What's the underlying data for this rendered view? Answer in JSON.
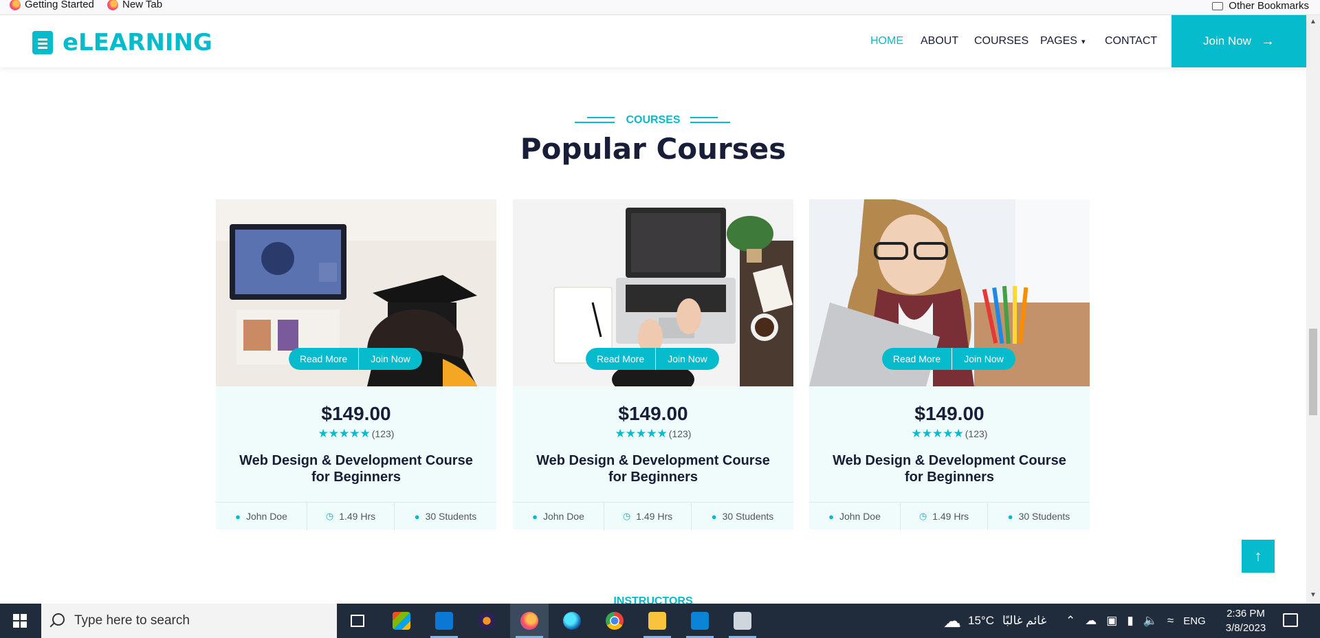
{
  "bookmarks": {
    "items": [
      {
        "label": "Getting Started"
      },
      {
        "label": "New Tab"
      }
    ],
    "other": "Other Bookmarks"
  },
  "nav": {
    "brand": "eLEARNING",
    "links": [
      "HOME",
      "ABOUT",
      "COURSES",
      "PAGES",
      "CONTACT"
    ],
    "active": "HOME",
    "join_label": "Join Now",
    "join_arrow": "→",
    "pages_chevron": "▾"
  },
  "section": {
    "tag": "COURSES",
    "title": "Popular Courses",
    "next_tag": "INSTRUCTORS"
  },
  "courses": [
    {
      "read_more": "Read More",
      "join": "Join Now",
      "price": "$149.00",
      "stars": "★★★★★",
      "reviews": "(123)",
      "title": "Web Design & Development Course for Beginners",
      "instructor": "John Doe",
      "duration": "1.49 Hrs",
      "students": "30 Students"
    },
    {
      "read_more": "Read More",
      "join": "Join Now",
      "price": "$149.00",
      "stars": "★★★★★",
      "reviews": "(123)",
      "title": "Web Design & Development Course for Beginners",
      "instructor": "John Doe",
      "duration": "1.49 Hrs",
      "students": "30 Students"
    },
    {
      "read_more": "Read More",
      "join": "Join Now",
      "price": "$149.00",
      "stars": "★★★★★",
      "reviews": "(123)",
      "title": "Web Design & Development Course for Beginners",
      "instructor": "John Doe",
      "duration": "1.49 Hrs",
      "students": "30 Students"
    }
  ],
  "back_to_top": "↑",
  "taskbar": {
    "search_placeholder": "Type here to search",
    "weather": "15°C",
    "weather_text": "غائم غالبًا",
    "language": "ENG",
    "time": "2:36 PM",
    "date": "3/8/2023"
  },
  "colors": {
    "accent": "#06bbcc",
    "dark": "#181d38",
    "card_bg": "#f0fbfc",
    "taskbar": "#202c3c"
  }
}
